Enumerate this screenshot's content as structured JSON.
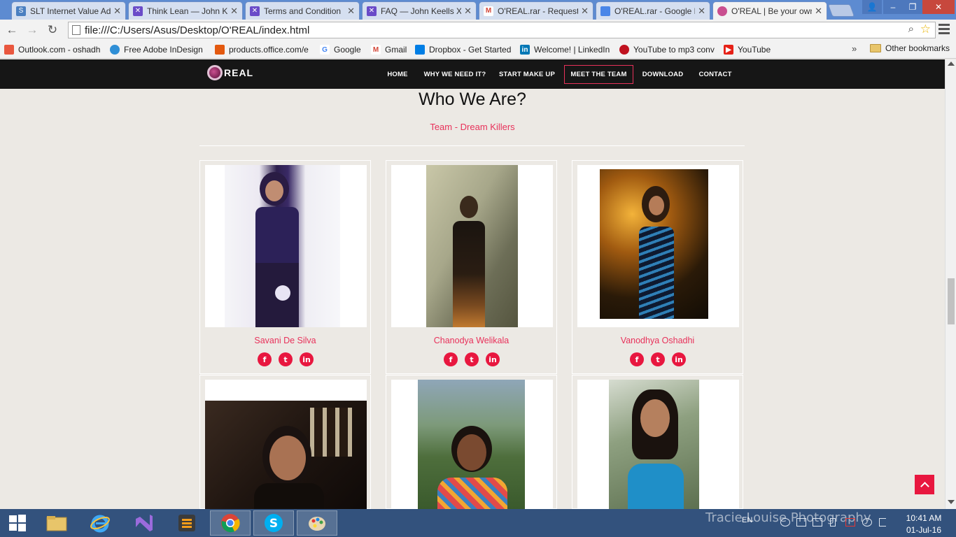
{
  "browser": {
    "tabs": [
      {
        "title": "SLT Internet Value Ad",
        "icon": "slt-icon",
        "color": "#4a7fc1"
      },
      {
        "title": "Think Lean — John Ke",
        "icon": "x-icon",
        "color": "#6a4bc8"
      },
      {
        "title": "Terms and Condition",
        "icon": "x-icon",
        "color": "#6a4bc8"
      },
      {
        "title": "FAQ — John Keells X",
        "icon": "x-icon",
        "color": "#6a4bc8"
      },
      {
        "title": "O'REAL.rar - Request",
        "icon": "gmail-icon",
        "color": "#d44638"
      },
      {
        "title": "O'REAL.rar - Google D",
        "icon": "google-docs-icon",
        "color": "#4a86e8"
      },
      {
        "title": "O'REAL | Be your own",
        "icon": "oreal-icon",
        "color": "#c94f8f",
        "active": true
      }
    ],
    "url": "file:///C:/Users/Asus/Desktop/O'REAL/index.html",
    "bookmarks": [
      {
        "label": "Outlook.com - oshadh",
        "icon": "windows-icon",
        "color": "#e9573f"
      },
      {
        "label": "Free Adobe InDesign",
        "icon": "refresh-icon",
        "color": "#2f8fd6"
      },
      {
        "label": "products.office.com/e",
        "icon": "office-icon",
        "color": "#e3590f"
      },
      {
        "label": "Google",
        "icon": "google-icon",
        "color": "#4285f4"
      },
      {
        "label": "Gmail",
        "icon": "gmail-icon",
        "color": "#d44638"
      },
      {
        "label": "Dropbox - Get Started",
        "icon": "dropbox-icon",
        "color": "#007ee5"
      },
      {
        "label": "Welcome! | LinkedIn",
        "icon": "linkedin-icon",
        "color": "#0077b5"
      },
      {
        "label": "YouTube to mp3 conv",
        "icon": "record-icon",
        "color": "#c0121f"
      },
      {
        "label": "YouTube",
        "icon": "youtube-icon",
        "color": "#e62117"
      }
    ],
    "more_bookmarks": "»",
    "other_bookmarks": "Other bookmarks"
  },
  "site": {
    "logo": "REAL",
    "nav": [
      {
        "label": "HOME",
        "active": false
      },
      {
        "label": "WHY WE NEED IT?",
        "active": false
      },
      {
        "label": "START MAKE UP",
        "active": false
      },
      {
        "label": "MEET THE TEAM",
        "active": true
      },
      {
        "label": "DOWNLOAD",
        "active": false
      },
      {
        "label": "CONTACT",
        "active": false
      }
    ],
    "section_title": "Who We Are?",
    "section_subtitle": "Team - Dream Killers",
    "social_glyphs": {
      "facebook": "f",
      "twitter": "t",
      "linkedin": "in"
    },
    "team": [
      {
        "name": "Savani De Silva"
      },
      {
        "name": "Chanodya Welikala"
      },
      {
        "name": "Vanodhya Oshadhi"
      },
      {
        "name": ""
      },
      {
        "name": ""
      },
      {
        "name": ""
      }
    ],
    "accent_color": "#e8315a"
  },
  "taskbar": {
    "watermark": "Tracie Louise Photography",
    "language": "EN",
    "time": "10:41 AM",
    "date": "01-Jul-16"
  }
}
